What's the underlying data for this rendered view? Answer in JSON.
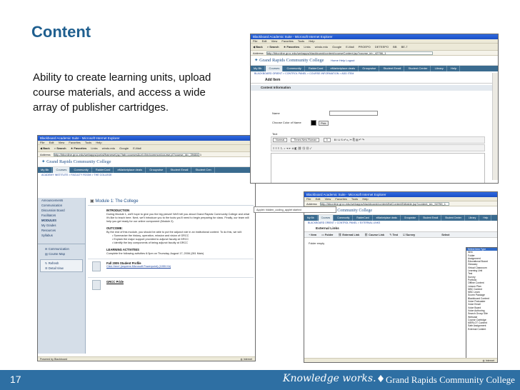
{
  "slide": {
    "title": "Content",
    "body": "Ability to create learning units, upload course materials, and access a wide array of publisher cartridges.",
    "page_number": "17",
    "footer_tagline": "Knowledge works.",
    "footer_college": "Grand Rapids Community College"
  },
  "colors": {
    "title": "#1f5f8f",
    "footer_bar": "#2e6fa3",
    "tab_bar": "#3a6b8f",
    "nav_bg": "#d5dee8"
  },
  "main_window": {
    "title": "Blackboard Academic Suite - Microsoft Internet Explorer",
    "menu": [
      "File",
      "Edit",
      "View",
      "Favorites",
      "Tools",
      "Help"
    ],
    "buttons": [
      "Back",
      "Search",
      "Favorites",
      "Links",
      "windo.edu",
      "Google",
      "E-Mail"
    ],
    "address": "http://bbonline.grcc.edu/webapps/portal/frameset.jsp?tab=courses&url=/bin/common/course.pl?course_id=_39484_1",
    "brand": "Grand Rapids Community College",
    "tabs": [
      "My Bb",
      "Courses",
      "Community",
      "RaiderCard",
      "eMarketplace deals",
      "Groupwise",
      "Student Email",
      "Student Cen"
    ],
    "crumb": "ACADEMY INSTITUTE > FACULTY ROOM > THE COLLEGE",
    "nav": [
      "Announcements",
      "Communication",
      "Discussion Board",
      "Facilitators",
      "MODULES",
      "My Grades",
      "Resources",
      "Syllabus"
    ],
    "nav_tools": [
      "Communication",
      "Course Map"
    ],
    "nav_box": [
      "Refresh",
      "Detail View"
    ],
    "module_title": "Module 1: The College",
    "sections": {
      "intro": "INTRODUCTION",
      "intro_text": "During Module 1, we'll hope to give you the big picture! We'll tell you about Grand Rapids Community College and what it's like to teach here. Next, we'll introduce you to the tools you'll need to begin preparing for class. Finally, our team will help you get ready for our online component (Module 2).",
      "outcome": "OUTCOME:",
      "outcome_text": "By the end of this module, you should be able to put the adjunct role in an institutional context. To do this, we will:",
      "bullets": [
        "Summarize the history, operation, mission and vision of GRCC",
        "Explain the major support provided to adjunct faculty at GRCC",
        "Identify the key components of being adjunct faculty at GRCC"
      ],
      "activities": "LEARNING ACTIVITIES",
      "activities_text": "Complete the following activities 6:3pm on Thursday, August 17, 2006 (281 Main)"
    },
    "items": [
      {
        "title": "Fall 2005 Student Profile",
        "link": "Click Here! (requires Microsoft Powerpoint) (1055 Kb)"
      },
      {
        "title": "GRCC Pride",
        "link": ""
      }
    ],
    "status_left": "Powered by Blackboard",
    "status_right": "Internet"
  },
  "top_window": {
    "title": "Blackboard Academic Suite - Microsoft Internet Explorer",
    "menu": [
      "File",
      "Edit",
      "View",
      "Favorites",
      "Tools",
      "Help"
    ],
    "buttons": [
      "Back",
      "Search",
      "Favorites",
      "Links",
      "windo.edu",
      "Google",
      "E-Mail",
      "PROEPO",
      "DETEEPO",
      "BB",
      "BE-7"
    ],
    "address": "http://bbonline.grcc.edu/webapps/blackboard/content/courseContent.jsp?course_id=_42766_1",
    "brand": "Grand Rapids Community College",
    "user_links": "Home  Help  Logout",
    "tabs": [
      "My Bb",
      "Courses",
      "Community",
      "RaiderCard",
      "eMarketplace deals",
      "Groupwise",
      "Student Email",
      "Student Center",
      "Library",
      "Help"
    ],
    "crumb": "BLACKBOARD ORIENT > CONTROL PANEL > COURSE INFORMATION > ADD ITEM",
    "page_title": "Add Item",
    "section": "Content Information",
    "name_label": "Name",
    "color_label": "Choose Color of Name",
    "pick_label": "Pick",
    "text_label": "Text",
    "style_value": "Normal",
    "font_value": "Times New Roman",
    "size_value": "3"
  },
  "bottom_window": {
    "title": "Blackboard Academic Suite - Microsoft Internet Explorer",
    "menu": [
      "File",
      "Edit",
      "View",
      "Favorites",
      "Tools",
      "Help"
    ],
    "address": "http://bbonline.grcc.edu/webapps/blackboard/content/listContentEditable.jsp?content_id=_92759_1",
    "brand": "Grand Rapids Community College",
    "tabs": [
      "My Bb",
      "Courses",
      "Community",
      "RaiderCard",
      "eMarketplace deals",
      "Groupwise",
      "Student Email",
      "Student Center",
      "Library",
      "Help"
    ],
    "crumb": "BLACKBOARD ORIENT > CONTROL PANEL > EXTERNAL LINKS",
    "page_title": "External Links",
    "tools": [
      "Item",
      "Folder",
      "External Link",
      "Course Link",
      "Test",
      "Survey"
    ],
    "select_label": "Select",
    "folder_empty": "Folder empty",
    "status_right": "Internet",
    "dropdown": [
      "Select Item Type",
      "Item",
      "Folder",
      "Assignment",
      "Educational Board",
      "Glossary",
      "Virtual Classroom",
      "Learning Unit",
      "Test",
      "Survey",
      "Portfolio",
      "Offline Content",
      "Lesson Plan",
      "NBC Content",
      "NBC Learn",
      "Scorm Package",
      "Blackboard Content",
      "Voice Podcaster",
      "Voice Email",
      "Voice Board",
      "Voice Authoring",
      "Search Group Site",
      "Webcast",
      "Course Cartridge",
      "MERLOT Content",
      "Safe Assignment",
      "External Content"
    ],
    "dropdown_selected": 0
  },
  "popup": {
    "text": "Applet: hidden_coding_applet started"
  }
}
